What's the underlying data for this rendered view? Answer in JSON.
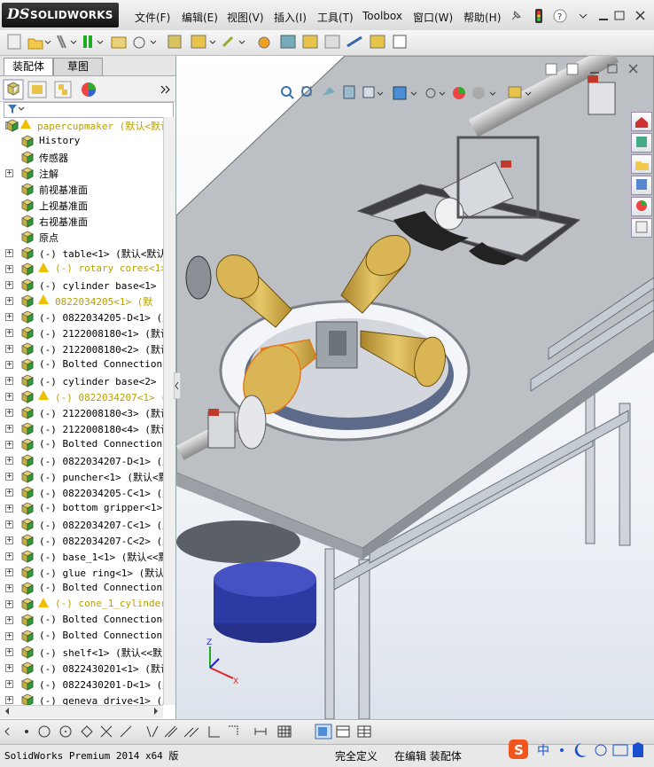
{
  "app": {
    "logo_ds": "DS",
    "logo_text": "SOLIDWORKS"
  },
  "menu": [
    {
      "label": "文件(F)"
    },
    {
      "label": "编辑(E)"
    },
    {
      "label": "视图(V)"
    },
    {
      "label": "插入(I)"
    },
    {
      "label": "工具(T)"
    },
    {
      "label": "Toolbox"
    },
    {
      "label": "窗口(W)"
    },
    {
      "label": "帮助(H)"
    }
  ],
  "panel_tabs": [
    {
      "label": "装配体"
    },
    {
      "label": "草图"
    }
  ],
  "tree": [
    {
      "text": "papercupmaker  (默认<默认_",
      "style": "warnc",
      "warn": true,
      "expand": "+",
      "indent": 0
    },
    {
      "text": "History",
      "indent": 1
    },
    {
      "text": "传感器",
      "style": "sans",
      "indent": 1
    },
    {
      "text": "注解",
      "style": "sans",
      "indent": 1,
      "expand": "+"
    },
    {
      "text": "前视基准面",
      "style": "sans",
      "indent": 1
    },
    {
      "text": "上视基准面",
      "style": "sans",
      "indent": 1
    },
    {
      "text": "右视基准面",
      "style": "sans",
      "indent": 1
    },
    {
      "text": "原点",
      "style": "sans",
      "indent": 1
    },
    {
      "text": "(-) table<1> (默认<默认",
      "expand": "+",
      "indent": 1
    },
    {
      "text": "(-) rotary cores<1>",
      "style": "warnc",
      "warn": true,
      "expand": "+",
      "indent": 1
    },
    {
      "text": "(-) cylinder base<1> (默",
      "expand": "+",
      "indent": 1
    },
    {
      "text": "0822034205<1> (默",
      "style": "warnc",
      "warn": true,
      "expand": "+",
      "indent": 1
    },
    {
      "text": "(-) 0822034205-D<1> (默",
      "expand": "+",
      "indent": 1
    },
    {
      "text": "(-) 2122008180<1> (默认",
      "expand": "+",
      "indent": 1
    },
    {
      "text": "(-) 2122008180<2> (默认",
      "expand": "+",
      "indent": 1
    },
    {
      "text": "(-) Bolted Connection1_",
      "expand": "+",
      "indent": 1
    },
    {
      "text": "(-) cylinder base<2> (默",
      "expand": "+",
      "indent": 1
    },
    {
      "text": "(-) 0822034207<1> (默",
      "style": "warnc",
      "warn": true,
      "expand": "+",
      "indent": 1
    },
    {
      "text": "(-) 2122008180<3> (默认",
      "expand": "+",
      "indent": 1
    },
    {
      "text": "(-) 2122008180<4> (默认",
      "expand": "+",
      "indent": 1
    },
    {
      "text": "(-) Bolted Connection2_",
      "expand": "+",
      "indent": 1
    },
    {
      "text": "(-) 0822034207-D<1> (默",
      "expand": "+",
      "indent": 1
    },
    {
      "text": "(-) puncher<1> (默认<默",
      "expand": "+",
      "indent": 1
    },
    {
      "text": "(-) 0822034205-C<1> (默",
      "expand": "+",
      "indent": 1
    },
    {
      "text": "(-) bottom gripper<1> (",
      "expand": "+",
      "indent": 1
    },
    {
      "text": "(-) 0822034207-C<1> (默",
      "expand": "+",
      "indent": 1
    },
    {
      "text": "(-) 0822034207-C<2> (默",
      "expand": "+",
      "indent": 1
    },
    {
      "text": "(-) base_1<1> (默认<<默",
      "expand": "+",
      "indent": 1
    },
    {
      "text": "(-) glue ring<1> (默认<",
      "expand": "+",
      "indent": 1
    },
    {
      "text": "(-) Bolted Connection3<",
      "expand": "+",
      "indent": 1
    },
    {
      "text": "(-) cone_1_cylinder<",
      "style": "warnc",
      "warn": true,
      "expand": "+",
      "indent": 1
    },
    {
      "text": "(-) Bolted Connection4<",
      "expand": "+",
      "indent": 1
    },
    {
      "text": "(-) Bolted Connection5<",
      "expand": "+",
      "indent": 1
    },
    {
      "text": "(-) shelf<1> (默认<<默",
      "expand": "+",
      "indent": 1
    },
    {
      "text": "(-) 0822430201<1> (默认",
      "expand": "+",
      "indent": 1
    },
    {
      "text": "(-) 0822430201-D<1> (默",
      "expand": "+",
      "indent": 1
    },
    {
      "text": "(-) geneva drive<1> (默",
      "expand": "+",
      "indent": 1
    }
  ],
  "status": {
    "product": "SolidWorks Premium 2014 x64 版",
    "definition": "完全定义",
    "mode": "在编辑 装配体"
  },
  "ime": {
    "label": "中"
  },
  "colors": {
    "accent_red": "#c0392b",
    "cup_gold": "#c9a544",
    "sheet_gray": "#bfc3c7"
  }
}
